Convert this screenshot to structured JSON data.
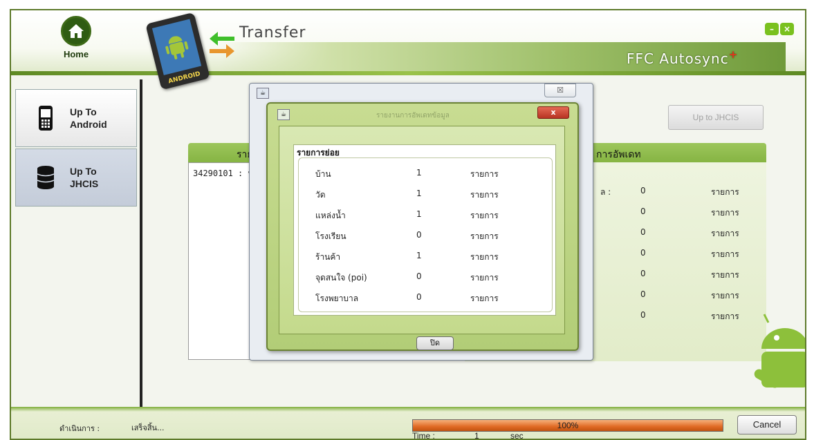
{
  "app": {
    "title": "Transfer",
    "brand": "FFC Autosync",
    "brand_plus": "+",
    "tablet_text": "ANDROID",
    "home_label": "Home",
    "minimize_label": "–",
    "close_label": "×"
  },
  "sidebar": {
    "items": [
      {
        "label_line1": "Up To",
        "label_line2": "Android"
      },
      {
        "label_line1": "Up To",
        "label_line2": "JHCIS"
      }
    ]
  },
  "toolbar": {
    "up_jhcis_label": "Up to JHCIS"
  },
  "panel": {
    "header_left": "ราย",
    "header_right": "การอัพเดท",
    "left_row_text": "34290101 : บ",
    "right_rows": [
      {
        "label": "ล :",
        "count": "0",
        "unit": "รายการ"
      },
      {
        "label": "",
        "count": "0",
        "unit": "รายการ"
      },
      {
        "label": "",
        "count": "0",
        "unit": "รายการ"
      },
      {
        "label": "",
        "count": "0",
        "unit": "รายการ"
      },
      {
        "label": "",
        "count": "0",
        "unit": "รายการ"
      },
      {
        "label": "",
        "count": "0",
        "unit": "รายการ"
      },
      {
        "label": "",
        "count": "0",
        "unit": "รายการ"
      }
    ]
  },
  "dialog": {
    "outer_close_label": "☒",
    "inner_title": "รายงานการอัพเดทข้อมูล",
    "inner_close_label": "x",
    "list_title": "รายการย่อย",
    "rows": [
      {
        "label": "บ้าน",
        "count": "1",
        "unit": "รายการ"
      },
      {
        "label": "วัด",
        "count": "1",
        "unit": "รายการ"
      },
      {
        "label": "แหล่งน้ำ",
        "count": "1",
        "unit": "รายการ"
      },
      {
        "label": "โรงเรียน",
        "count": "0",
        "unit": "รายการ"
      },
      {
        "label": "ร้านค้า",
        "count": "1",
        "unit": "รายการ"
      },
      {
        "label": "จุดสนใจ (poi)",
        "count": "0",
        "unit": "รายการ"
      },
      {
        "label": "โรงพยาบาล",
        "count": "0",
        "unit": "รายการ"
      }
    ],
    "close_button_label": "ปิด"
  },
  "footer": {
    "status_label": "ดำเนินการ :",
    "status_value": "เสร็จสิ้น...",
    "progress_text": "100%",
    "progress_value": 1.0,
    "time_label": "Time :",
    "time_value": "1",
    "time_unit": "sec",
    "cancel_label": "Cancel"
  }
}
